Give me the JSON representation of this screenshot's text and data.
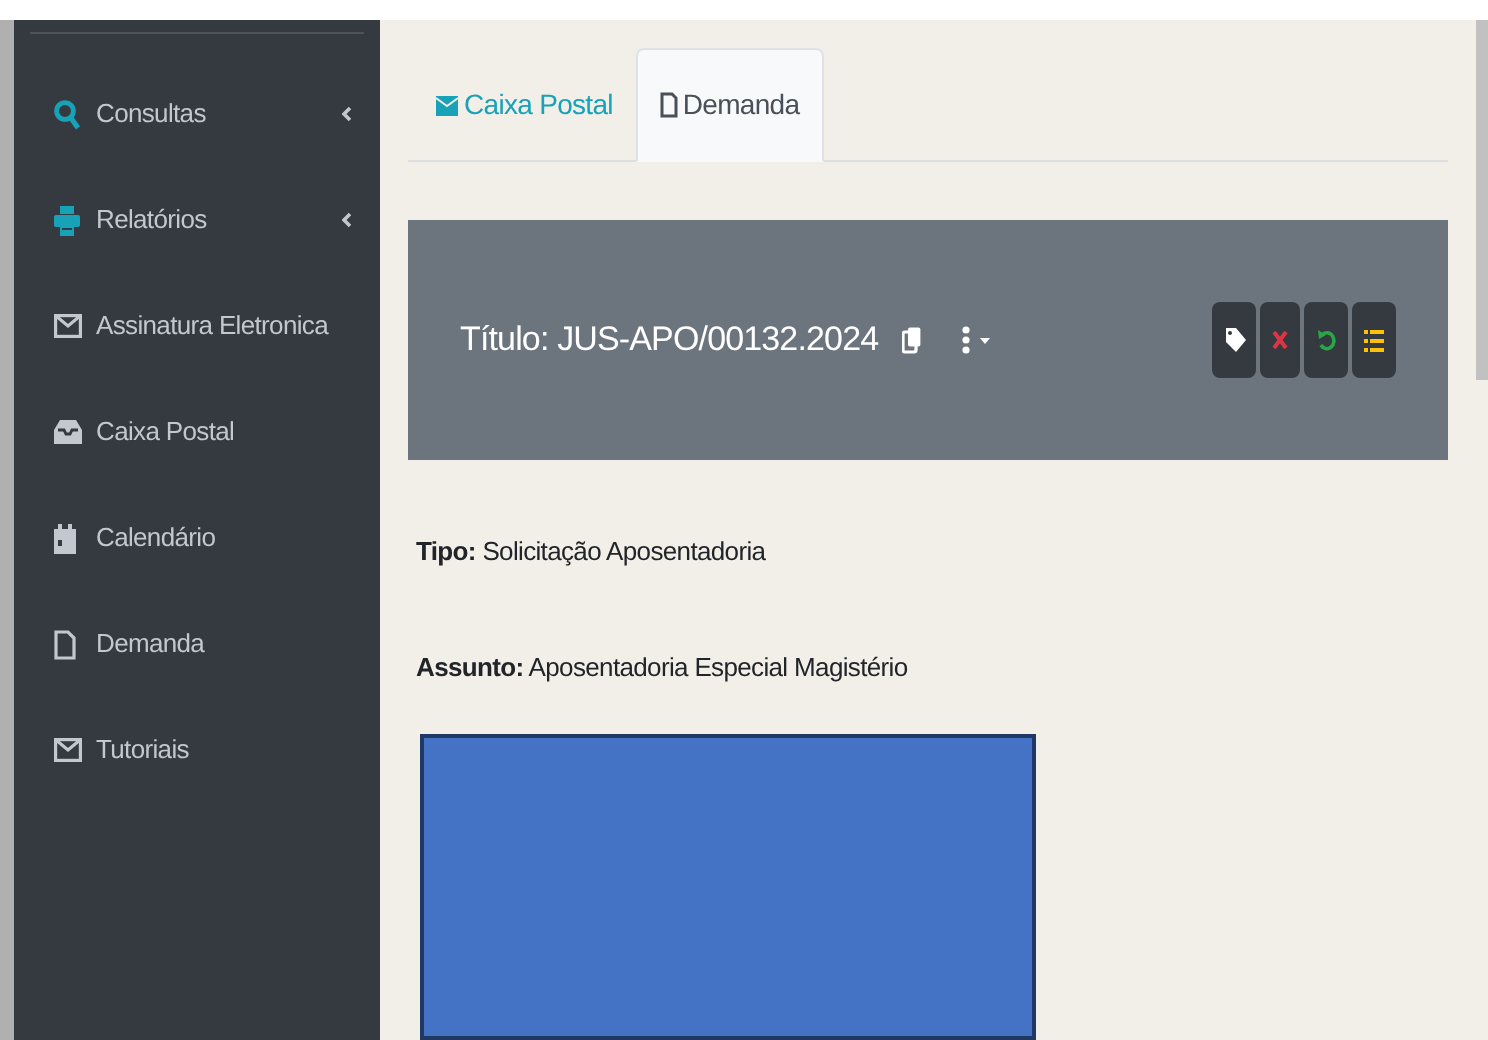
{
  "sidebar": {
    "items": [
      {
        "label": "Consultas",
        "has_submenu": true
      },
      {
        "label": "Relatórios",
        "has_submenu": true
      },
      {
        "label": "Assinatura Eletronica",
        "has_submenu": false
      },
      {
        "label": "Caixa Postal",
        "has_submenu": false
      },
      {
        "label": "Calendário",
        "has_submenu": false
      },
      {
        "label": "Demanda",
        "has_submenu": false
      },
      {
        "label": "Tutoriais",
        "has_submenu": false
      }
    ]
  },
  "tabs": [
    {
      "label": "Caixa Postal",
      "selected": false
    },
    {
      "label": "Demanda",
      "selected": true
    }
  ],
  "header": {
    "title": "Título: JUS-APO/00132.2024"
  },
  "fields": [
    {
      "label": "Tipo:",
      "value": "Solicitação Aposentadoria"
    },
    {
      "label": "Assunto:",
      "value": "Aposentadoria Especial Magistério"
    }
  ]
}
